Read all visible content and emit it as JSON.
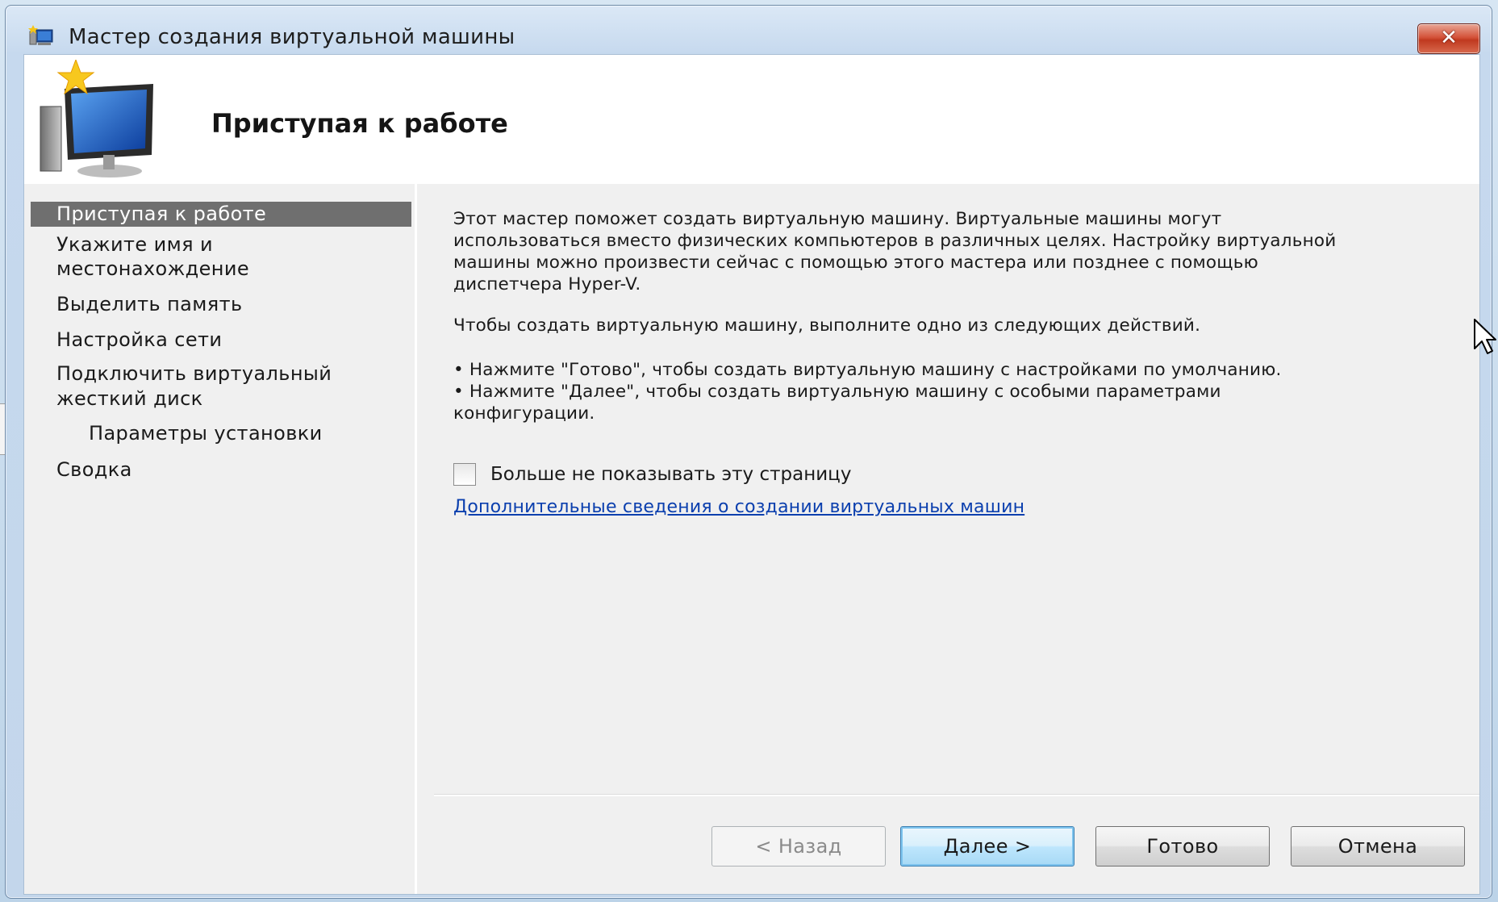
{
  "window": {
    "title": "Мастер создания виртуальной машины",
    "close_label": "✕"
  },
  "header": {
    "title": "Приступая к работе"
  },
  "steps": [
    {
      "label": "Приступая к работе",
      "active": true
    },
    {
      "label": "Укажите имя и",
      "active": false
    },
    {
      "label": "местонахождение",
      "active": false
    },
    {
      "label": "Выделить память",
      "active": false
    },
    {
      "label": "Настройка сети",
      "active": false
    },
    {
      "label": "Подключить виртуальный",
      "active": false
    },
    {
      "label": "жесткий диск",
      "active": false
    },
    {
      "label": "Параметры установки",
      "active": false
    },
    {
      "label": "Сводка",
      "active": false
    }
  ],
  "main": {
    "intro_lines": [
      "Этот мастер поможет создать виртуальную машину. Виртуальные машины могут",
      "использоваться вместо физических компьютеров в различных целях. Настройку виртуальной",
      "машины можно произвести сейчас с помощью этого мастера или позднее с помощью",
      "диспетчера Hyper-V."
    ],
    "instruction": "Чтобы создать виртуальную машину, выполните одно из следующих действий.",
    "bullets": [
      "• Нажмите \"Готово\", чтобы создать виртуальную машину с настройками по умолчанию.",
      "• Нажмите \"Далее\", чтобы создать виртуальную машину с особыми параметрами",
      "конфигурации."
    ],
    "checkbox_label": "Больше не показывать эту страницу",
    "checkbox_checked": false,
    "link_text": "Дополнительные сведения о создании виртуальных машин"
  },
  "buttons": {
    "back": "< Назад",
    "next": "Далее >",
    "finish": "Готово",
    "cancel": "Отмена"
  },
  "colors": {
    "active_step_bg": "#6f6f6f",
    "link": "#0b3fae",
    "close_button": "#c0391f"
  }
}
